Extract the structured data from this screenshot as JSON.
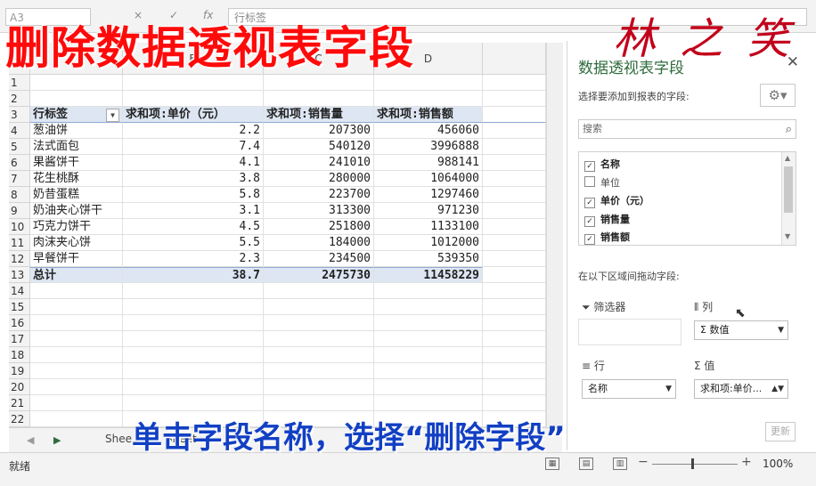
{
  "formula_bar": {
    "name_box": "A3",
    "content": "行标签",
    "cancel_icon": "×",
    "enter_icon": "✓",
    "fx_label": "fx"
  },
  "columns": [
    "B",
    "C",
    "D"
  ],
  "rows": [
    {
      "num": "1",
      "cells": [
        "",
        "",
        "",
        ""
      ]
    },
    {
      "num": "2",
      "cells": [
        "",
        "",
        "",
        ""
      ]
    },
    {
      "num": "3",
      "type": "header",
      "cells": [
        "行标签",
        "求和项:单价（元）",
        "求和项:销售量",
        "求和项:销售额"
      ]
    },
    {
      "num": "4",
      "cells": [
        "葱油饼",
        "2.2",
        "207300",
        "456060"
      ]
    },
    {
      "num": "5",
      "cells": [
        "法式面包",
        "7.4",
        "540120",
        "3996888"
      ]
    },
    {
      "num": "6",
      "cells": [
        "果酱饼干",
        "4.1",
        "241010",
        "988141"
      ]
    },
    {
      "num": "7",
      "cells": [
        "花生桃酥",
        "3.8",
        "280000",
        "1064000"
      ]
    },
    {
      "num": "8",
      "cells": [
        "奶昔蛋糕",
        "5.8",
        "223700",
        "1297460"
      ]
    },
    {
      "num": "9",
      "cells": [
        "奶油夹心饼干",
        "3.1",
        "313300",
        "971230"
      ]
    },
    {
      "num": "10",
      "cells": [
        "巧克力饼干",
        "4.5",
        "251800",
        "1133100"
      ]
    },
    {
      "num": "11",
      "cells": [
        "肉沫夹心饼",
        "5.5",
        "184000",
        "1012000"
      ]
    },
    {
      "num": "12",
      "cells": [
        "早餐饼干",
        "2.3",
        "234500",
        "539350"
      ]
    },
    {
      "num": "13",
      "type": "total",
      "cells": [
        "总计",
        "38.7",
        "2475730",
        "11458229"
      ]
    },
    {
      "num": "14",
      "cells": [
        "",
        "",
        "",
        ""
      ]
    },
    {
      "num": "15",
      "cells": [
        "",
        "",
        "",
        ""
      ]
    },
    {
      "num": "16",
      "cells": [
        "",
        "",
        "",
        ""
      ]
    },
    {
      "num": "17",
      "cells": [
        "",
        "",
        "",
        ""
      ]
    },
    {
      "num": "18",
      "cells": [
        "",
        "",
        "",
        ""
      ]
    },
    {
      "num": "19",
      "cells": [
        "",
        "",
        "",
        ""
      ]
    },
    {
      "num": "20",
      "cells": [
        "",
        "",
        "",
        ""
      ]
    },
    {
      "num": "21",
      "cells": [
        "",
        "",
        "",
        ""
      ]
    },
    {
      "num": "22",
      "cells": [
        "",
        "",
        "",
        ""
      ]
    }
  ],
  "sheet_tabs": [
    "Shee",
    "Sheet"
  ],
  "status": {
    "ready": "就绪",
    "zoom": "100%"
  },
  "pivot_panel": {
    "title": "数据透视表字段",
    "choose_label": "选择要添加到报表的字段:",
    "search_placeholder": "搜索",
    "fields": [
      {
        "label": "名称",
        "checked": true
      },
      {
        "label": "单位",
        "checked": false
      },
      {
        "label": "单价（元）",
        "checked": true
      },
      {
        "label": "销售量",
        "checked": true
      },
      {
        "label": "销售额",
        "checked": true
      }
    ],
    "drag_label": "在以下区域间拖动字段:",
    "areas": {
      "filters": {
        "title": "筛选器"
      },
      "columns": {
        "title": "列",
        "item": "Σ 数值"
      },
      "rows": {
        "title": "行",
        "item": "名称"
      },
      "values": {
        "title": "Σ 值",
        "item": "求和项:单价..."
      }
    },
    "update_label": "更新"
  },
  "overlay": {
    "title": "删除数据透视表字段",
    "signature": "林 之 笑",
    "caption": "单击字段名称，选择“删除字段”"
  },
  "colors": {
    "title_red": "#ff0a0a",
    "caption_blue": "#1240c4",
    "pivot_header_bg": "#dde6f2",
    "panel_title_green": "#2e6b3e"
  }
}
